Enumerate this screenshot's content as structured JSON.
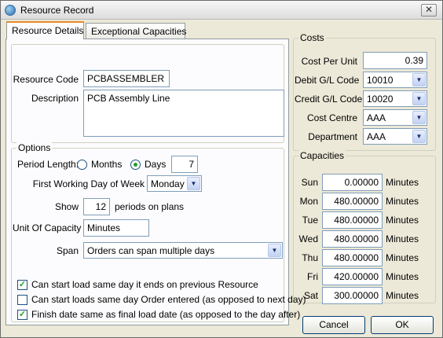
{
  "window": {
    "title": "Resource Record",
    "close_glyph": "✕"
  },
  "tabs": [
    {
      "label": "Resource Details"
    },
    {
      "label": "Exceptional Capacities"
    }
  ],
  "resource": {
    "code_label": "Resource Code",
    "code_value": "PCBASSEMBLER",
    "desc_label": "Description",
    "desc_value": "PCB Assembly Line"
  },
  "options": {
    "legend": "Options",
    "period_label": "Period Length:",
    "months_label": "Months",
    "days_label": "Days",
    "days_value": "7",
    "first_day_label": "First Working Day of Week",
    "first_day_value": "Monday",
    "show_label": "Show",
    "show_value": "12",
    "periods_label": "periods on plans",
    "unit_label": "Unit Of Capacity",
    "unit_value": "Minutes",
    "span_label": "Span",
    "span_value": "Orders can span multiple days",
    "check1": "Can start load same day it ends on previous Resource",
    "check2": "Can start loads same day Order entered (as opposed to next day)",
    "check3": "Finish date same as final load date (as opposed to the day after)",
    "check_states": [
      true,
      false,
      true
    ]
  },
  "costs": {
    "legend": "Costs",
    "cpu_label": "Cost Per Unit",
    "cpu_value": "0.39",
    "debit_label": "Debit G/L Code",
    "debit_value": "10010",
    "credit_label": "Credit G/L Code",
    "credit_value": "10020",
    "centre_label": "Cost Centre",
    "centre_value": "AAA",
    "dept_label": "Department",
    "dept_value": "AAA"
  },
  "capacities": {
    "legend": "Capacities",
    "unit": "Minutes",
    "days": [
      {
        "day": "Sun",
        "value": "0.00000"
      },
      {
        "day": "Mon",
        "value": "480.00000"
      },
      {
        "day": "Tue",
        "value": "480.00000"
      },
      {
        "day": "Wed",
        "value": "480.00000"
      },
      {
        "day": "Thu",
        "value": "480.00000"
      },
      {
        "day": "Fri",
        "value": "420.00000"
      },
      {
        "day": "Sat",
        "value": "300.00000"
      }
    ]
  },
  "buttons": {
    "cancel": "Cancel",
    "ok": "OK"
  }
}
